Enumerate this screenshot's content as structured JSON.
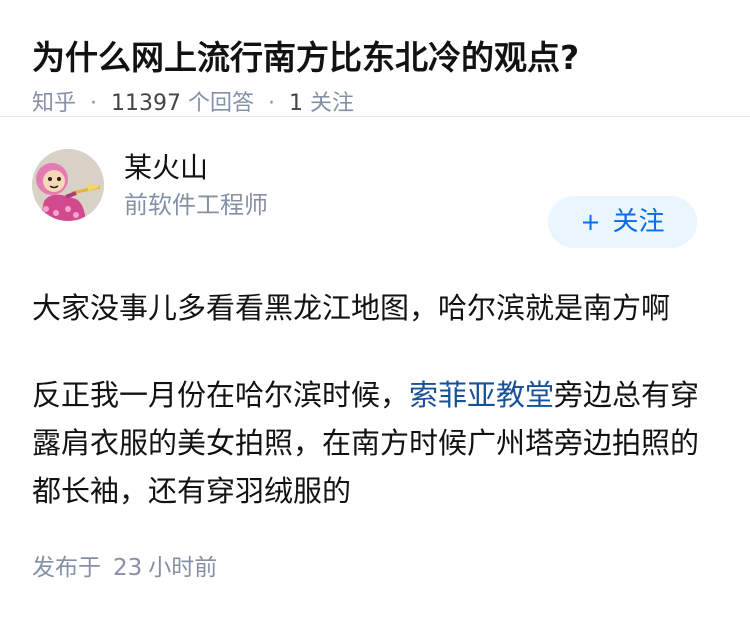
{
  "question": {
    "title": "为什么网上流行南方比东北冷的观点?",
    "source": "知乎",
    "answer_count": "11397",
    "answer_label": "个回答",
    "follow_count": "1",
    "follow_label": "关注"
  },
  "author": {
    "name": "某火山",
    "bio": "前软件工程师",
    "avatar_icon": "cartoon-avatar-icon",
    "follow_button": {
      "plus": "+",
      "label": "关注"
    }
  },
  "answer": {
    "paragraph1": "大家没事儿多看看黑龙江地图，哈尔滨就是南方啊",
    "paragraph2_before": "反正我一月份在哈尔滨时候，",
    "paragraph2_link": "索菲亚教堂",
    "paragraph2_after": "旁边总有穿露肩衣服的美女拍照，在南方时候广州塔旁边拍照的都长袖，还有穿羽绒服的"
  },
  "publish": {
    "prefix": "发布于",
    "number": "23",
    "suffix": "小时前"
  },
  "colors": {
    "link": "#175199",
    "follow_text": "#056de8",
    "follow_bg": "#ebf5ff",
    "meta": "#8590a6"
  }
}
